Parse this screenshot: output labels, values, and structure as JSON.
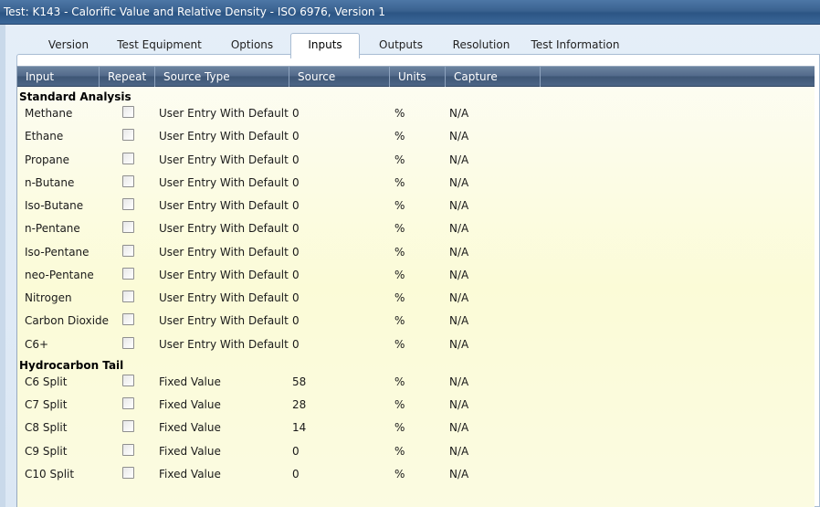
{
  "window": {
    "title": "Test: K143 - Calorific Value and Relative Density - ISO 6976, Version 1"
  },
  "tabs": [
    {
      "label": "Version"
    },
    {
      "label": "Test Equipment"
    },
    {
      "label": "Options"
    },
    {
      "label": "Inputs",
      "active": true
    },
    {
      "label": "Outputs"
    },
    {
      "label": "Resolution"
    },
    {
      "label": "Test Information"
    }
  ],
  "grid": {
    "columns": [
      "Input",
      "Repeat",
      "Source Type",
      "Source",
      "Units",
      "Capture"
    ],
    "groups": [
      {
        "name": "Standard Analysis",
        "rows": [
          {
            "input": "Methane",
            "repeat": false,
            "source_type": "User Entry With Default",
            "source": "0",
            "units": "%",
            "capture": "N/A"
          },
          {
            "input": "Ethane",
            "repeat": false,
            "source_type": "User Entry With Default",
            "source": "0",
            "units": "%",
            "capture": "N/A"
          },
          {
            "input": "Propane",
            "repeat": false,
            "source_type": "User Entry With Default",
            "source": "0",
            "units": "%",
            "capture": "N/A"
          },
          {
            "input": "n-Butane",
            "repeat": false,
            "source_type": "User Entry With Default",
            "source": "0",
            "units": "%",
            "capture": "N/A"
          },
          {
            "input": "Iso-Butane",
            "repeat": false,
            "source_type": "User Entry With Default",
            "source": "0",
            "units": "%",
            "capture": "N/A"
          },
          {
            "input": "n-Pentane",
            "repeat": false,
            "source_type": "User Entry With Default",
            "source": "0",
            "units": "%",
            "capture": "N/A"
          },
          {
            "input": "Iso-Pentane",
            "repeat": false,
            "source_type": "User Entry With Default",
            "source": "0",
            "units": "%",
            "capture": "N/A"
          },
          {
            "input": "neo-Pentane",
            "repeat": false,
            "source_type": "User Entry With Default",
            "source": "0",
            "units": "%",
            "capture": "N/A"
          },
          {
            "input": "Nitrogen",
            "repeat": false,
            "source_type": "User Entry With Default",
            "source": "0",
            "units": "%",
            "capture": "N/A"
          },
          {
            "input": "Carbon Dioxide",
            "repeat": false,
            "source_type": "User Entry With Default",
            "source": "0",
            "units": "%",
            "capture": "N/A"
          },
          {
            "input": "C6+",
            "repeat": false,
            "source_type": "User Entry With Default",
            "source": "0",
            "units": "%",
            "capture": "N/A"
          }
        ]
      },
      {
        "name": "Hydrocarbon Tail",
        "rows": [
          {
            "input": "C6 Split",
            "repeat": false,
            "source_type": "Fixed Value",
            "source": "58",
            "units": "%",
            "capture": "N/A"
          },
          {
            "input": "C7 Split",
            "repeat": false,
            "source_type": "Fixed Value",
            "source": "28",
            "units": "%",
            "capture": "N/A"
          },
          {
            "input": "C8 Split",
            "repeat": false,
            "source_type": "Fixed Value",
            "source": "14",
            "units": "%",
            "capture": "N/A"
          },
          {
            "input": "C9 Split",
            "repeat": false,
            "source_type": "Fixed Value",
            "source": "0",
            "units": "%",
            "capture": "N/A"
          },
          {
            "input": "C10 Split",
            "repeat": false,
            "source_type": "Fixed Value",
            "source": "0",
            "units": "%",
            "capture": "N/A"
          }
        ]
      }
    ]
  }
}
